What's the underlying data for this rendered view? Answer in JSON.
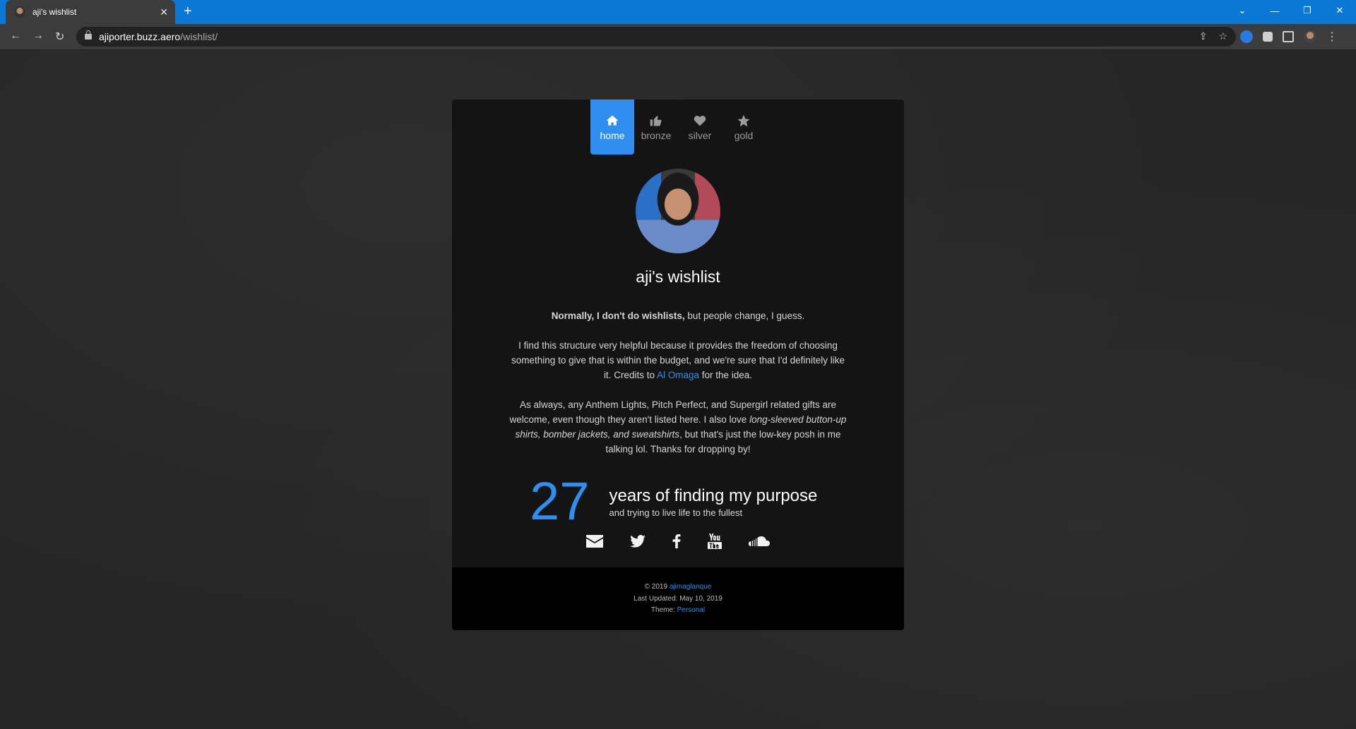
{
  "browser": {
    "tab_title": "aji's wishlist",
    "tab_close": "✕",
    "new_tab": "+",
    "url_host": "ajiporter.buzz.aero",
    "url_path": "/wishlist/",
    "nav": {
      "back": "←",
      "forward": "→",
      "reload": "↻"
    },
    "window": {
      "tab_search": "⌄",
      "minimize": "—",
      "restore": "❐",
      "close": "✕"
    },
    "omni_icons": {
      "share": "⇪",
      "bookmark": "☆"
    },
    "ext_menu": "⋮"
  },
  "nav": {
    "items": [
      {
        "label": "home",
        "icon": "home-icon"
      },
      {
        "label": "bronze",
        "icon": "thumbs-up-icon"
      },
      {
        "label": "silver",
        "icon": "heart-icon"
      },
      {
        "label": "gold",
        "icon": "star-icon"
      }
    ]
  },
  "profile": {
    "title": "aji's wishlist"
  },
  "intro": {
    "p1_bold": "Normally, I don't do wishlists,",
    "p1_rest": " but people change, I guess.",
    "p2_a": "I find this structure very helpful because it provides the freedom of choosing something to give that is within the budget, and we're sure that I'd definitely like it. Credits to ",
    "p2_link": "Al Omaga",
    "p2_b": " for the idea.",
    "p3_a": "As always, any Anthem Lights, Pitch Perfect, and Supergirl related gifts are welcome, even though they aren't listed here. I also love ",
    "p3_em": "long-sleeved button-up shirts, bomber jackets, and sweatshirts",
    "p3_b": ", but that's just the low-key posh in me talking lol. Thanks for dropping by!"
  },
  "age": {
    "number": "27",
    "title": "years of finding my purpose",
    "subtitle": "and trying to live life to the fullest"
  },
  "social": [
    "envelope-icon",
    "twitter-icon",
    "facebook-icon",
    "youtube-icon",
    "soundcloud-icon"
  ],
  "footer": {
    "copyright": "© 2019 ",
    "author": "ajimaglanque",
    "updated": "Last Updated: May 10, 2019",
    "theme_label": "Theme: ",
    "theme_link": "Personal"
  },
  "colors": {
    "accent": "#2e8ff0",
    "chrome": "#0a78d4",
    "card": "#141414"
  }
}
